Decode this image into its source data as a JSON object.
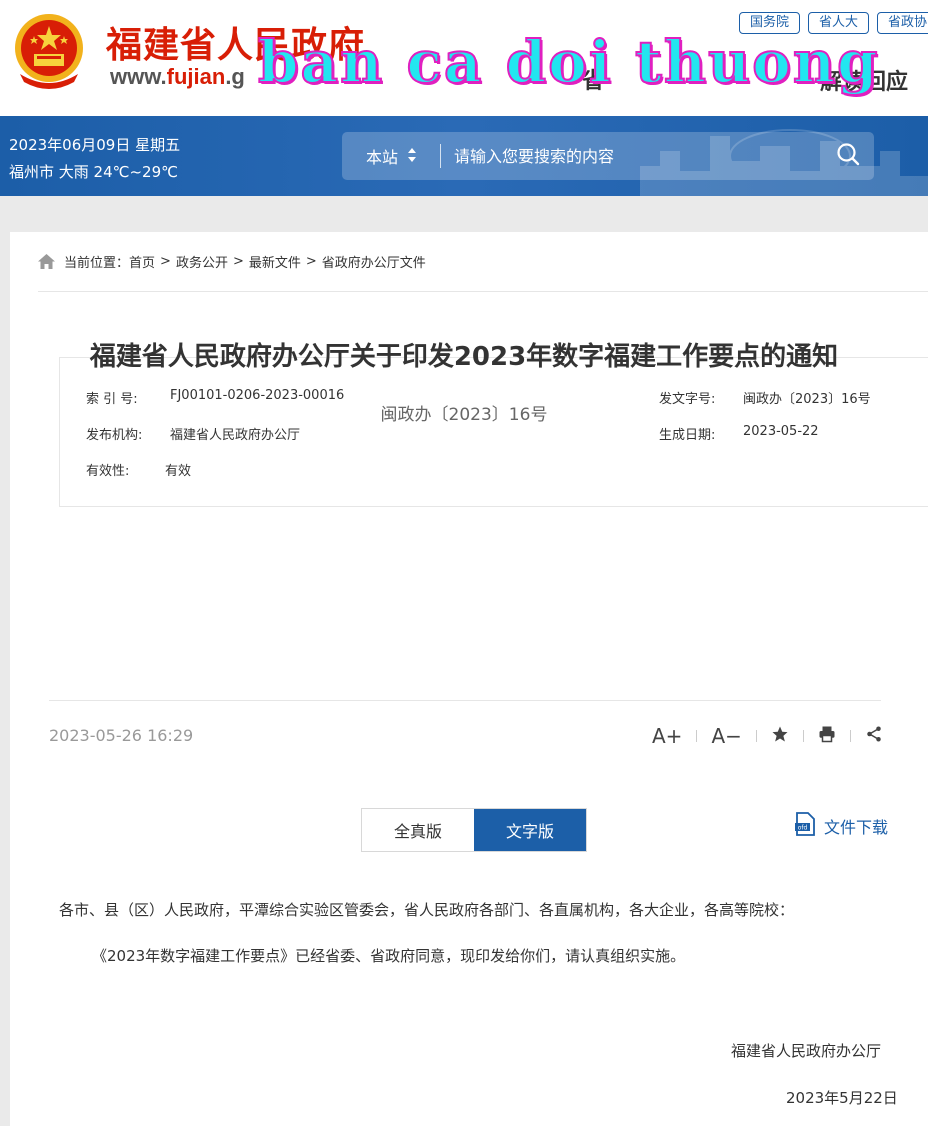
{
  "header": {
    "site_name": "福建省人民政府",
    "site_url_prefix": "www.",
    "site_url_accent": "fujian",
    "site_url_suffix": ".g",
    "top_links": [
      "国务院",
      "省人大",
      "省政协"
    ],
    "nav_peek": "省",
    "nav_reply": "解读回应",
    "watermark": "ban ca doi thuong"
  },
  "banner": {
    "date": "2023年06月09日 星期五",
    "weather": "福州市 大雨 24℃~29℃",
    "search_scope": "本站",
    "search_placeholder": "请输入您要搜索的内容"
  },
  "breadcrumb": {
    "prefix": "当前位置：",
    "items": [
      "首页",
      "政务公开",
      "最新文件",
      "省政府办公厅文件"
    ]
  },
  "meta": {
    "index_label": "索 引 号:",
    "index_value": "FJ00101-0206-2023-00016",
    "doc_no_label": "发文字号:",
    "doc_no_value": "闽政办〔2023〕16号",
    "issuer_label": "发布机构:",
    "issuer_value": "福建省人民政府办公厅",
    "created_label": "生成日期:",
    "created_value": "2023-05-22",
    "validity_label": "有效性:",
    "validity_value": "有效"
  },
  "article": {
    "title": "福建省人民政府办公厅关于印发2023年数字福建工作要点的通知",
    "doc_number": "闽政办〔2023〕16号",
    "publish_time": "2023-05-26 16:29",
    "tools": {
      "font_up": "A+",
      "font_down": "A−"
    },
    "tabs": [
      "全真版",
      "文字版"
    ],
    "download_label": "文件下载",
    "salutation": "各市、县（区）人民政府，平潭综合实验区管委会，省人民政府各部门、各直属机构，各大企业，各高等院校：",
    "paragraph": "《2023年数字福建工作要点》已经省委、省政府同意，现印发给你们，请认真组织实施。",
    "signature": "福建省人民政府办公厅",
    "sign_date": "2023年5月22日"
  },
  "colors": {
    "brand_red": "#d81e06",
    "primary_blue": "#1c5fa8"
  }
}
